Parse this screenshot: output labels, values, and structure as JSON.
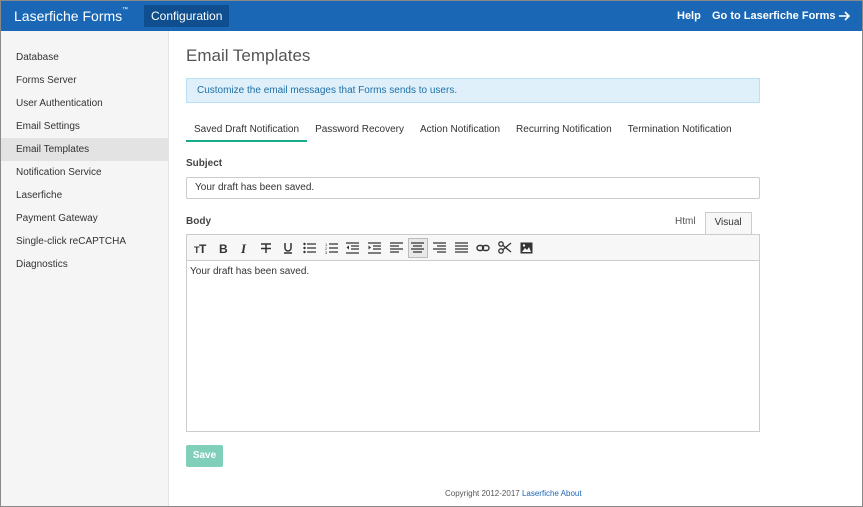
{
  "header": {
    "brand": "Laserfiche Forms",
    "brand_tm": "™",
    "config_tab": "Configuration",
    "help": "Help",
    "goto": "Go to Laserfiche Forms"
  },
  "sidebar": {
    "items": [
      {
        "label": "Database"
      },
      {
        "label": "Forms Server"
      },
      {
        "label": "User Authentication"
      },
      {
        "label": "Email Settings"
      },
      {
        "label": "Email Templates",
        "active": true
      },
      {
        "label": "Notification Service"
      },
      {
        "label": "Laserfiche"
      },
      {
        "label": "Payment Gateway"
      },
      {
        "label": "Single-click reCAPTCHA"
      },
      {
        "label": "Diagnostics"
      }
    ]
  },
  "main": {
    "title": "Email Templates",
    "info": "Customize the email messages that Forms sends to users.",
    "tabs": [
      {
        "label": "Saved Draft Notification",
        "active": true
      },
      {
        "label": "Password Recovery"
      },
      {
        "label": "Action Notification"
      },
      {
        "label": "Recurring Notification"
      },
      {
        "label": "Termination Notification"
      }
    ],
    "subject_label": "Subject",
    "subject_value": "Your draft has been saved.",
    "body_label": "Body",
    "mode_html": "Html",
    "mode_visual": "Visual",
    "body_value": "Your draft has been saved.",
    "save": "Save"
  },
  "footer": {
    "copyright": "Copyright 2012-2017",
    "link1": "Laserfiche",
    "link2": "About"
  },
  "colors": {
    "nav": "#1a68b5",
    "active_tab_underline": "#1aab8a",
    "save_button": "#7fcfbb"
  }
}
